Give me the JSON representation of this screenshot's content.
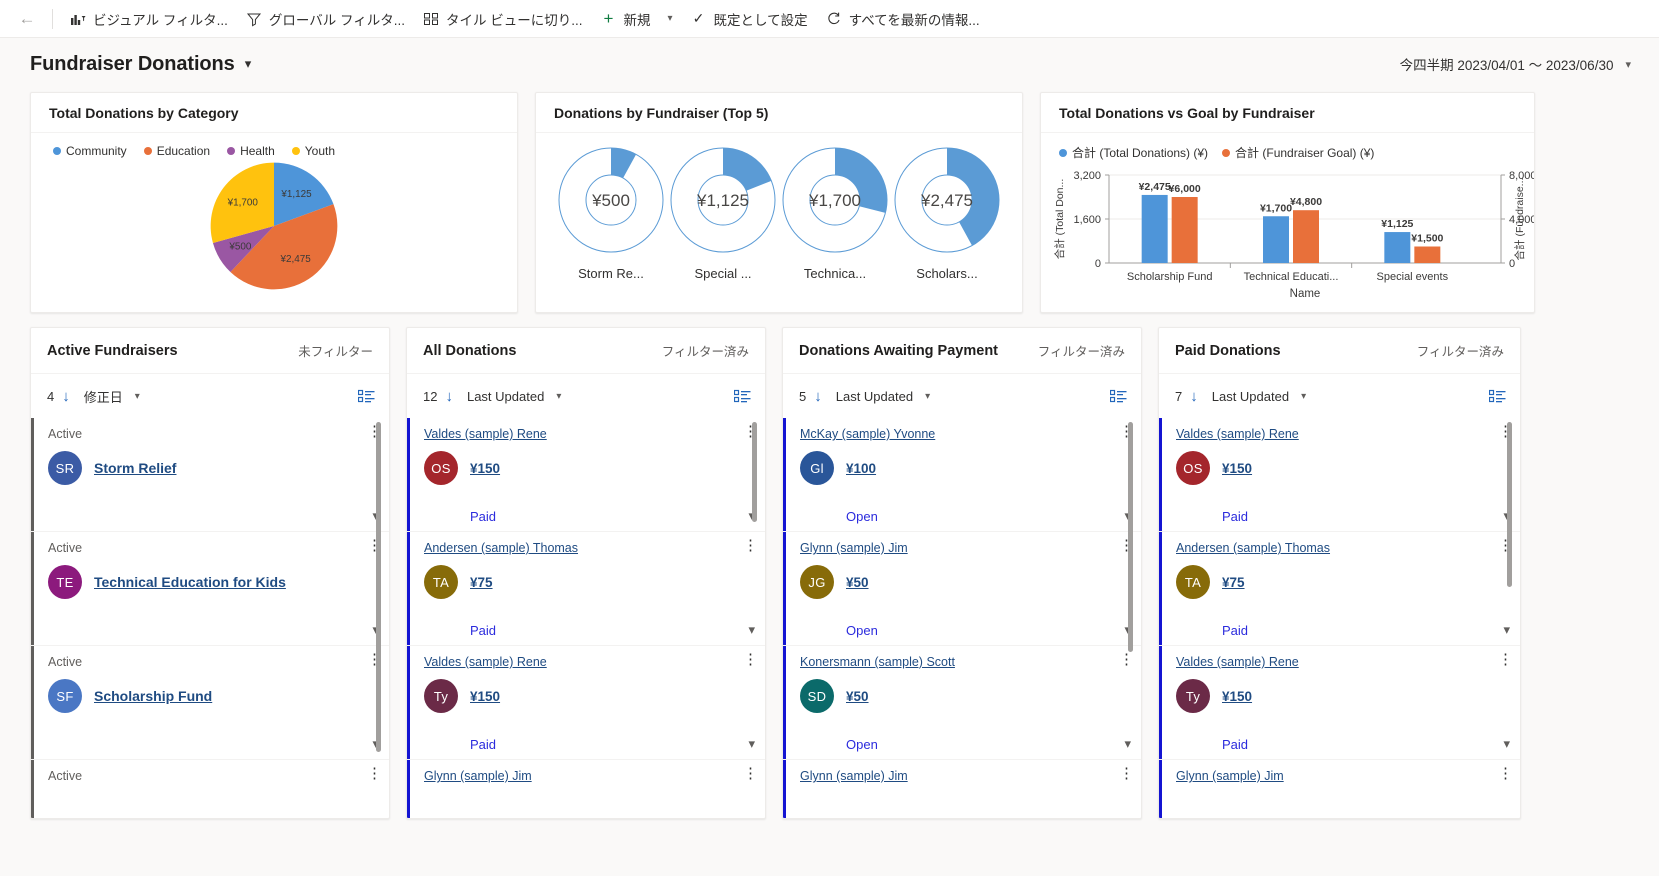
{
  "commandbar": {
    "back_label": "back-arrow",
    "items": [
      {
        "icon": "chart-filter-icon",
        "label": "ビジュアル フィルタ...",
        "caret": false
      },
      {
        "icon": "funnel-icon",
        "label": "グローバル フィルタ...",
        "caret": false
      },
      {
        "icon": "tile-view-icon",
        "label": "タイル ビューに切り...",
        "caret": false
      },
      {
        "icon": "plus-icon",
        "label": "新規",
        "caret": true
      },
      {
        "icon": "check-icon",
        "label": "既定として設定",
        "caret": false
      },
      {
        "icon": "refresh-icon",
        "label": "すべてを最新の情報...",
        "caret": false
      }
    ]
  },
  "header": {
    "title": "Fundraiser Donations",
    "title_caret": "⌄",
    "date_range": "今四半期 2023/04/01 〜 2023/06/30",
    "date_caret": "⌄"
  },
  "charts": {
    "pie": {
      "title": "Total Donations by Category",
      "legend": [
        {
          "label": "Community",
          "color": "#4e95d9"
        },
        {
          "label": "Education",
          "color": "#e8703a"
        },
        {
          "label": "Health",
          "color": "#9a57a3"
        },
        {
          "label": "Youth",
          "color": "#ffc20e"
        }
      ]
    },
    "donut": {
      "title": "Donations by Fundraiser (Top 5)",
      "items": [
        {
          "value_label": "¥500",
          "name": "Storm Re...",
          "pct": 8
        },
        {
          "value_label": "¥1,125",
          "name": "Special ...",
          "pct": 19
        },
        {
          "value_label": "¥1,700",
          "name": "Technica...",
          "pct": 29
        },
        {
          "value_label": "¥2,475",
          "name": "Scholars...",
          "pct": 42
        }
      ]
    },
    "bars": {
      "title": "Total Donations vs Goal by Fundraiser",
      "legend": [
        {
          "label": "合計 (Total Donations) (¥)",
          "color": "#4e95d9"
        },
        {
          "label": "合計 (Fundraiser Goal) (¥)",
          "color": "#e8703a"
        }
      ],
      "y_left_label": "合計 (Total Don...",
      "y_right_label": "合計 (Fundraise...",
      "x_label": "Name"
    }
  },
  "chart_data": [
    {
      "type": "pie",
      "title": "Total Donations by Category",
      "categories": [
        "Community",
        "Education",
        "Health",
        "Youth"
      ],
      "values": [
        1125,
        2475,
        500,
        1700
      ],
      "labels": [
        "¥1,125",
        "¥2,475",
        "¥500",
        "¥1,700"
      ],
      "colors": [
        "#4e95d9",
        "#e8703a",
        "#9a57a3",
        "#ffc20e"
      ],
      "legend_position": "top"
    },
    {
      "type": "pie",
      "title": "Donations by Fundraiser (Top 5)",
      "subtype": "donut-gauge-series",
      "categories": [
        "Storm Re...",
        "Special ...",
        "Technica...",
        "Scholars..."
      ],
      "values": [
        500,
        1125,
        1700,
        2475
      ],
      "labels": [
        "¥500",
        "¥1,125",
        "¥1,700",
        "¥2,475"
      ],
      "colors": [
        "#4e95d9",
        "#4e95d9",
        "#4e95d9",
        "#4e95d9"
      ]
    },
    {
      "type": "bar",
      "title": "Total Donations vs Goal by Fundraiser",
      "categories": [
        "Scholarship Fund",
        "Technical Educati...",
        "Special events"
      ],
      "series": [
        {
          "name": "合計 (Total Donations) (¥)",
          "values": [
            2475,
            1700,
            1125
          ],
          "labels": [
            "¥2,475",
            "¥1,700",
            "¥1,125"
          ],
          "color": "#4e95d9",
          "axis": "left"
        },
        {
          "name": "合計 (Fundraiser Goal) (¥)",
          "values": [
            6000,
            4800,
            1500
          ],
          "labels": [
            "¥6,000",
            "¥4,800",
            "¥1,500"
          ],
          "color": "#e8703a",
          "axis": "right"
        }
      ],
      "xlabel": "Name",
      "ylabel": "合計 (Total Don...",
      "y2label": "合計 (Fundraise...",
      "ylim": [
        0,
        3200
      ],
      "yticks": [
        "0",
        "1,600",
        "3,200"
      ],
      "y2lim": [
        0,
        8000
      ],
      "y2ticks": [
        "0",
        "4,000",
        "8,000"
      ],
      "grid": true,
      "legend_position": "top"
    }
  ],
  "streams": [
    {
      "title": "Active Fundraisers",
      "filter_status": "未フィルター",
      "count": "4",
      "sort_field": "修正日",
      "accent": "#605e5c",
      "items": [
        {
          "top": "Active",
          "top_type": "status",
          "initials": "SR",
          "avatar_color": "#3b5ba5",
          "name": "Storm Relief",
          "state": "",
          "show_chevron": true
        },
        {
          "top": "Active",
          "top_type": "status",
          "initials": "TE",
          "avatar_color": "#8c1a7d",
          "name": "Technical Education for Kids",
          "state": "",
          "show_chevron": true
        },
        {
          "top": "Active",
          "top_type": "status",
          "initials": "SF",
          "avatar_color": "#4a77c4",
          "name": "Scholarship Fund",
          "state": "",
          "show_chevron": true
        },
        {
          "top": "Active",
          "top_type": "status",
          "initials": "",
          "avatar_color": "#3b5ba5",
          "name": "",
          "state": "",
          "show_chevron": false
        }
      ]
    },
    {
      "title": "All Donations",
      "filter_status": "フィルター済み",
      "count": "12",
      "sort_field": "Last Updated",
      "accent": "#1414d2",
      "items": [
        {
          "top": "Valdes (sample) Rene",
          "top_type": "link",
          "initials": "OS",
          "avatar_color": "#a4262c",
          "amount": "¥150",
          "state": "Paid",
          "show_chevron": true
        },
        {
          "top": "Andersen (sample) Thomas",
          "top_type": "link",
          "initials": "TA",
          "avatar_color": "#876b09",
          "amount": "¥75",
          "state": "Paid",
          "show_chevron": true
        },
        {
          "top": "Valdes (sample) Rene",
          "top_type": "link",
          "initials": "Ty",
          "avatar_color": "#6b2a47",
          "amount": "¥150",
          "state": "Paid",
          "show_chevron": true
        },
        {
          "top": "Glynn (sample) Jim",
          "top_type": "link",
          "initials": "",
          "avatar_color": "#6b2a47",
          "amount": "",
          "state": "",
          "show_chevron": false
        }
      ]
    },
    {
      "title": "Donations Awaiting Payment",
      "filter_status": "フィルター済み",
      "count": "5",
      "sort_field": "Last Updated",
      "accent": "#1414d2",
      "items": [
        {
          "top": "McKay (sample) Yvonne",
          "top_type": "link",
          "initials": "Gl",
          "avatar_color": "#2a5699",
          "amount": "¥100",
          "state": "Open",
          "show_chevron": true
        },
        {
          "top": "Glynn (sample) Jim",
          "top_type": "link",
          "initials": "JG",
          "avatar_color": "#876b09",
          "amount": "¥50",
          "state": "Open",
          "show_chevron": true
        },
        {
          "top": "Konersmann (sample) Scott",
          "top_type": "link",
          "initials": "SD",
          "avatar_color": "#0b6a6a",
          "amount": "¥50",
          "state": "Open",
          "show_chevron": true
        },
        {
          "top": "Glynn (sample) Jim",
          "top_type": "link",
          "initials": "",
          "avatar_color": "#0b6a6a",
          "amount": "",
          "state": "",
          "show_chevron": false
        }
      ]
    },
    {
      "title": "Paid Donations",
      "filter_status": "フィルター済み",
      "count": "7",
      "sort_field": "Last Updated",
      "accent": "#1414d2",
      "items": [
        {
          "top": "Valdes (sample) Rene",
          "top_type": "link",
          "initials": "OS",
          "avatar_color": "#a4262c",
          "amount": "¥150",
          "state": "Paid",
          "show_chevron": true
        },
        {
          "top": "Andersen (sample) Thomas",
          "top_type": "link",
          "initials": "TA",
          "avatar_color": "#876b09",
          "amount": "¥75",
          "state": "Paid",
          "show_chevron": true
        },
        {
          "top": "Valdes (sample) Rene",
          "top_type": "link",
          "initials": "Ty",
          "avatar_color": "#6b2a47",
          "amount": "¥150",
          "state": "Paid",
          "show_chevron": true
        },
        {
          "top": "Glynn (sample) Jim",
          "top_type": "link",
          "initials": "",
          "avatar_color": "#6b2a47",
          "amount": "",
          "state": "",
          "show_chevron": false
        }
      ]
    }
  ]
}
